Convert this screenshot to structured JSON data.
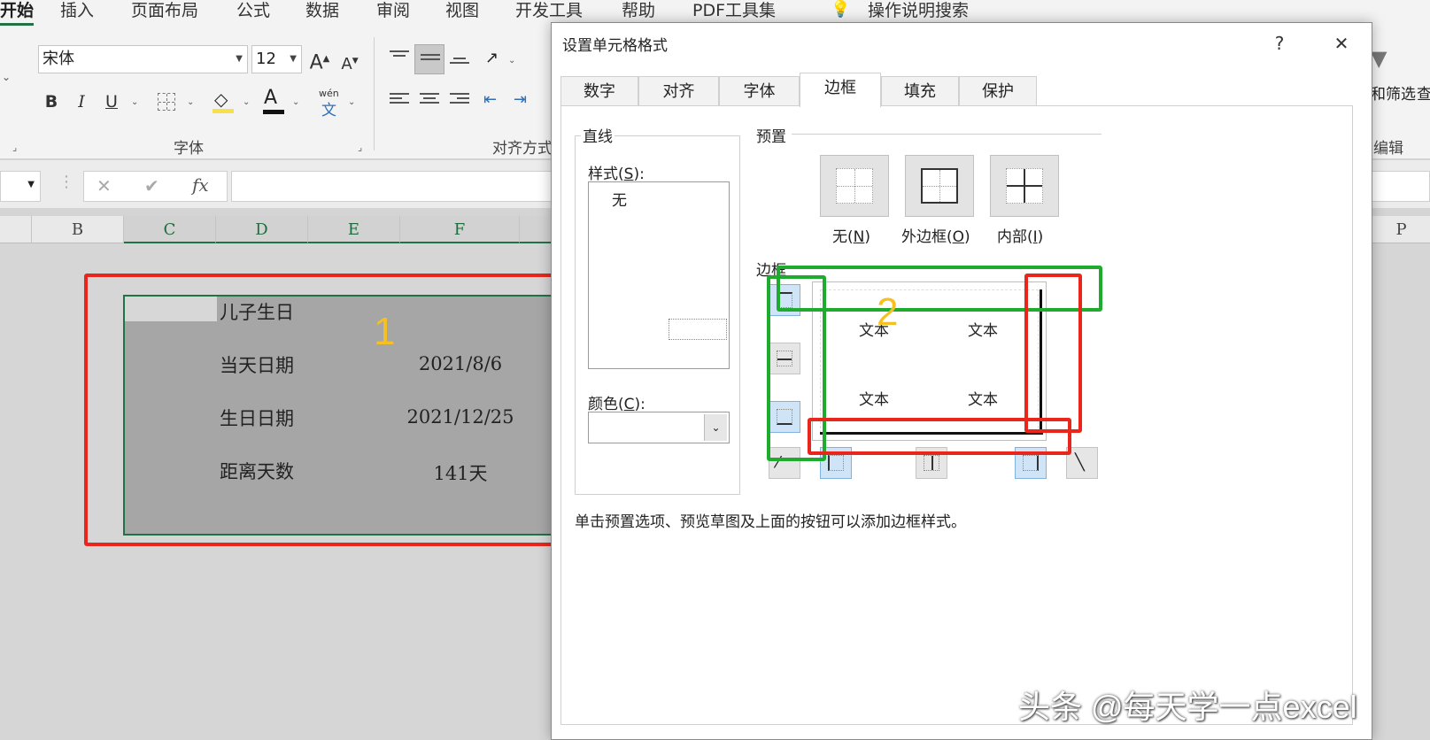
{
  "ribbon": {
    "tabs": [
      "开始",
      "插入",
      "页面布局",
      "公式",
      "数据",
      "审阅",
      "视图",
      "开发工具",
      "帮助",
      "PDF工具集"
    ],
    "tell_me": "操作说明搜索",
    "font_name": "宋体",
    "font_size": "12",
    "bold": "B",
    "italic": "I",
    "underline": "U",
    "font_group_label": "字体",
    "align_group_label": "对齐方式",
    "edit_group_label": "编辑",
    "filter_label": "和筛选",
    "find_label": "查",
    "phonetic_top": "wén",
    "phonetic_bottom": "文",
    "grow_font": "A",
    "shrink_font": "A",
    "font_color": "A"
  },
  "formula_bar": {
    "fx": "fx",
    "cancel": "✕",
    "enter": "✔",
    "value": ""
  },
  "columns": [
    "B",
    "C",
    "D",
    "E",
    "F",
    "P"
  ],
  "sheet": {
    "title": "儿子生日",
    "rows": [
      {
        "label": "当天日期",
        "value": "2021/8/6"
      },
      {
        "label": "生日日期",
        "value": "2021/12/25"
      },
      {
        "label": "距离天数",
        "value": "141天"
      }
    ]
  },
  "dialog": {
    "title": "设置单元格格式",
    "help": "?",
    "close": "✕",
    "tabs": [
      "数字",
      "对齐",
      "字体",
      "边框",
      "填充",
      "保护"
    ],
    "active_tab": "边框",
    "line_group": "直线",
    "style_label_pre": "样式(",
    "style_key": "S",
    "style_label_post": "):",
    "style_none": "无",
    "color_label_pre": "颜色(",
    "color_key": "C",
    "color_label_post": "):",
    "preset_group": "预置",
    "presets": [
      {
        "pre": "无(",
        "key": "N",
        "post": ")"
      },
      {
        "pre": "外边框(",
        "key": "O",
        "post": ")"
      },
      {
        "pre": "内部(",
        "key": "I",
        "post": ")"
      }
    ],
    "border_group": "边框",
    "preview_text": [
      "文本",
      "文本",
      "文本",
      "文本"
    ],
    "hint": "单击预置选项、预览草图及上面的按钮可以添加边框样式。"
  },
  "annotations": {
    "one": "1",
    "two": "2"
  },
  "watermark": "头条 @每天学一点excel",
  "colors": {
    "accent": "#217346",
    "red_mark": "#e8261c",
    "green_mark": "#1fac2e",
    "number_mark": "#f5c022"
  }
}
